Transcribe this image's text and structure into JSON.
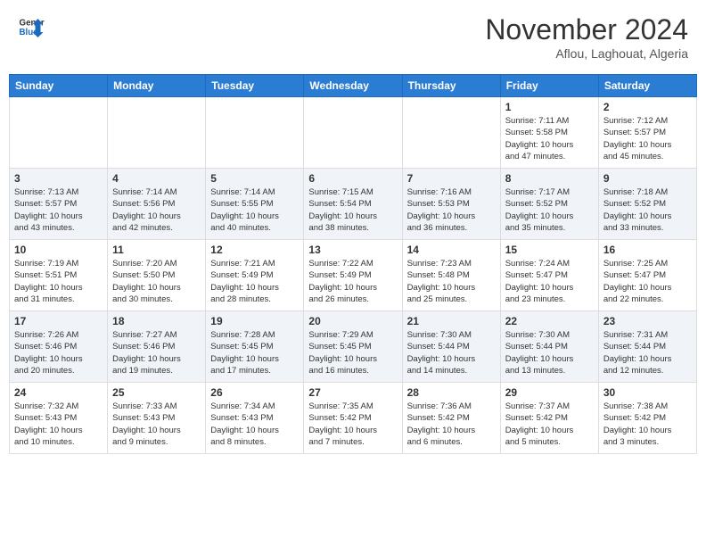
{
  "header": {
    "logo_general": "General",
    "logo_blue": "Blue",
    "month_title": "November 2024",
    "location": "Aflou, Laghouat, Algeria"
  },
  "weekdays": [
    "Sunday",
    "Monday",
    "Tuesday",
    "Wednesday",
    "Thursday",
    "Friday",
    "Saturday"
  ],
  "weeks": [
    [
      {
        "day": "",
        "info": ""
      },
      {
        "day": "",
        "info": ""
      },
      {
        "day": "",
        "info": ""
      },
      {
        "day": "",
        "info": ""
      },
      {
        "day": "",
        "info": ""
      },
      {
        "day": "1",
        "info": "Sunrise: 7:11 AM\nSunset: 5:58 PM\nDaylight: 10 hours\nand 47 minutes."
      },
      {
        "day": "2",
        "info": "Sunrise: 7:12 AM\nSunset: 5:57 PM\nDaylight: 10 hours\nand 45 minutes."
      }
    ],
    [
      {
        "day": "3",
        "info": "Sunrise: 7:13 AM\nSunset: 5:57 PM\nDaylight: 10 hours\nand 43 minutes."
      },
      {
        "day": "4",
        "info": "Sunrise: 7:14 AM\nSunset: 5:56 PM\nDaylight: 10 hours\nand 42 minutes."
      },
      {
        "day": "5",
        "info": "Sunrise: 7:14 AM\nSunset: 5:55 PM\nDaylight: 10 hours\nand 40 minutes."
      },
      {
        "day": "6",
        "info": "Sunrise: 7:15 AM\nSunset: 5:54 PM\nDaylight: 10 hours\nand 38 minutes."
      },
      {
        "day": "7",
        "info": "Sunrise: 7:16 AM\nSunset: 5:53 PM\nDaylight: 10 hours\nand 36 minutes."
      },
      {
        "day": "8",
        "info": "Sunrise: 7:17 AM\nSunset: 5:52 PM\nDaylight: 10 hours\nand 35 minutes."
      },
      {
        "day": "9",
        "info": "Sunrise: 7:18 AM\nSunset: 5:52 PM\nDaylight: 10 hours\nand 33 minutes."
      }
    ],
    [
      {
        "day": "10",
        "info": "Sunrise: 7:19 AM\nSunset: 5:51 PM\nDaylight: 10 hours\nand 31 minutes."
      },
      {
        "day": "11",
        "info": "Sunrise: 7:20 AM\nSunset: 5:50 PM\nDaylight: 10 hours\nand 30 minutes."
      },
      {
        "day": "12",
        "info": "Sunrise: 7:21 AM\nSunset: 5:49 PM\nDaylight: 10 hours\nand 28 minutes."
      },
      {
        "day": "13",
        "info": "Sunrise: 7:22 AM\nSunset: 5:49 PM\nDaylight: 10 hours\nand 26 minutes."
      },
      {
        "day": "14",
        "info": "Sunrise: 7:23 AM\nSunset: 5:48 PM\nDaylight: 10 hours\nand 25 minutes."
      },
      {
        "day": "15",
        "info": "Sunrise: 7:24 AM\nSunset: 5:47 PM\nDaylight: 10 hours\nand 23 minutes."
      },
      {
        "day": "16",
        "info": "Sunrise: 7:25 AM\nSunset: 5:47 PM\nDaylight: 10 hours\nand 22 minutes."
      }
    ],
    [
      {
        "day": "17",
        "info": "Sunrise: 7:26 AM\nSunset: 5:46 PM\nDaylight: 10 hours\nand 20 minutes."
      },
      {
        "day": "18",
        "info": "Sunrise: 7:27 AM\nSunset: 5:46 PM\nDaylight: 10 hours\nand 19 minutes."
      },
      {
        "day": "19",
        "info": "Sunrise: 7:28 AM\nSunset: 5:45 PM\nDaylight: 10 hours\nand 17 minutes."
      },
      {
        "day": "20",
        "info": "Sunrise: 7:29 AM\nSunset: 5:45 PM\nDaylight: 10 hours\nand 16 minutes."
      },
      {
        "day": "21",
        "info": "Sunrise: 7:30 AM\nSunset: 5:44 PM\nDaylight: 10 hours\nand 14 minutes."
      },
      {
        "day": "22",
        "info": "Sunrise: 7:30 AM\nSunset: 5:44 PM\nDaylight: 10 hours\nand 13 minutes."
      },
      {
        "day": "23",
        "info": "Sunrise: 7:31 AM\nSunset: 5:44 PM\nDaylight: 10 hours\nand 12 minutes."
      }
    ],
    [
      {
        "day": "24",
        "info": "Sunrise: 7:32 AM\nSunset: 5:43 PM\nDaylight: 10 hours\nand 10 minutes."
      },
      {
        "day": "25",
        "info": "Sunrise: 7:33 AM\nSunset: 5:43 PM\nDaylight: 10 hours\nand 9 minutes."
      },
      {
        "day": "26",
        "info": "Sunrise: 7:34 AM\nSunset: 5:43 PM\nDaylight: 10 hours\nand 8 minutes."
      },
      {
        "day": "27",
        "info": "Sunrise: 7:35 AM\nSunset: 5:42 PM\nDaylight: 10 hours\nand 7 minutes."
      },
      {
        "day": "28",
        "info": "Sunrise: 7:36 AM\nSunset: 5:42 PM\nDaylight: 10 hours\nand 6 minutes."
      },
      {
        "day": "29",
        "info": "Sunrise: 7:37 AM\nSunset: 5:42 PM\nDaylight: 10 hours\nand 5 minutes."
      },
      {
        "day": "30",
        "info": "Sunrise: 7:38 AM\nSunset: 5:42 PM\nDaylight: 10 hours\nand 3 minutes."
      }
    ]
  ]
}
